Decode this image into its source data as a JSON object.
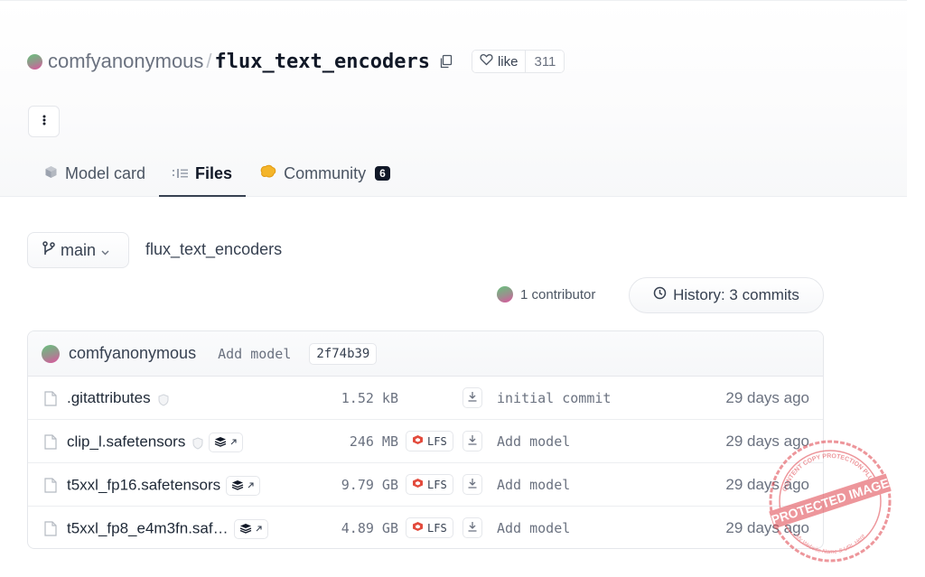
{
  "repo": {
    "owner": "comfyanonymous",
    "separator": "/",
    "name": "flux_text_encoders",
    "like_label": "like",
    "like_count": "311"
  },
  "tabs": [
    {
      "label": "Model card",
      "icon": "cube-icon",
      "active": false
    },
    {
      "label": "Files",
      "icon": "files-list-icon",
      "active": true
    },
    {
      "label": "Community",
      "icon": "community-icon",
      "active": false,
      "badge": "6"
    }
  ],
  "branch": {
    "label": "main"
  },
  "path": "flux_text_encoders",
  "contributors_label": "1 contributor",
  "history_label": "History: 3 commits",
  "last_commit": {
    "author": "comfyanonymous",
    "message": "Add model",
    "hash": "2f74b39"
  },
  "files": [
    {
      "name": ".gitattributes",
      "size": "1.52 kB",
      "lfs": false,
      "commit": "initial commit",
      "date": "29 days ago"
    },
    {
      "name": "clip_l.safetensors",
      "size": "246 MB",
      "lfs": true,
      "lfs_label": "LFS",
      "commit": "Add model",
      "date": "29 days ago"
    },
    {
      "name": "t5xxl_fp16.safetensors",
      "size": "9.79 GB",
      "lfs": true,
      "lfs_label": "LFS",
      "commit": "Add model",
      "date": "29 days ago"
    },
    {
      "name": "t5xxl_fp8_e4m3fn.saf…",
      "size": "4.89 GB",
      "lfs": true,
      "lfs_label": "LFS",
      "commit": "Add model",
      "date": "29 days ago"
    }
  ],
  "watermark": {
    "text": "PROTECTED IMAGE",
    "top_text": "CONTENT COPY PROTECTION PLUGIN",
    "bottom_text": "My Website Name & URL Here",
    "color": "#e0424b"
  }
}
